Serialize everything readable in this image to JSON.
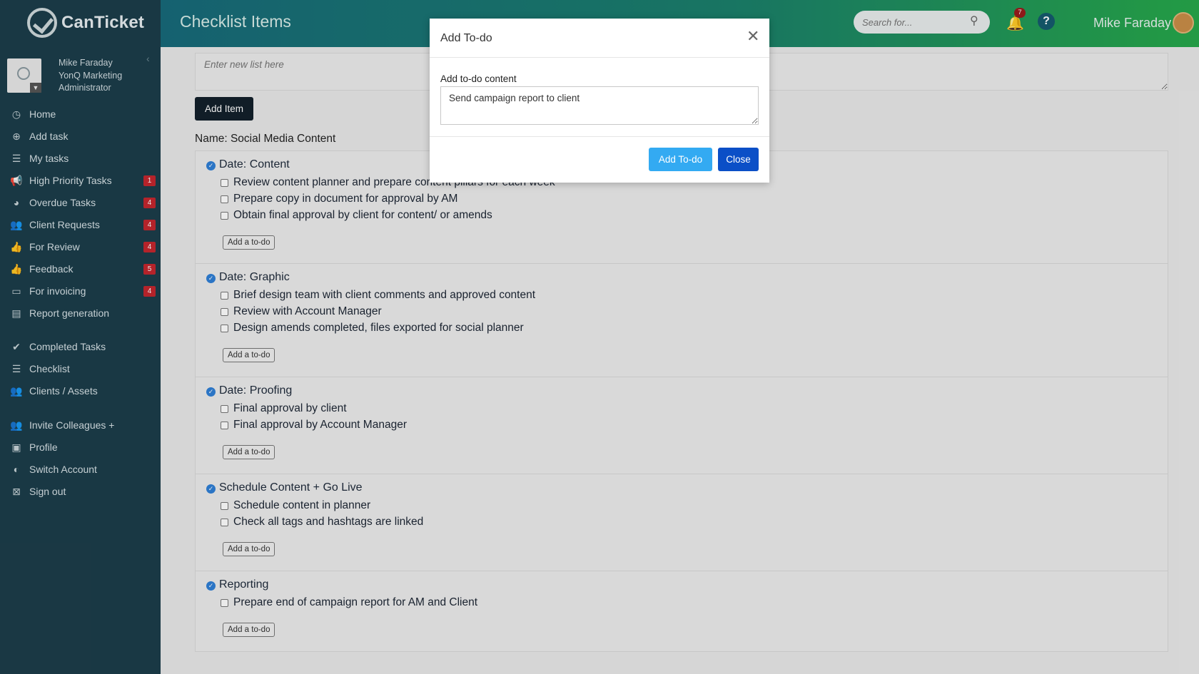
{
  "app": {
    "name": "CanTicket",
    "page_title": "Checklist Items"
  },
  "sidebar": {
    "user": {
      "name": "Mike Faraday",
      "company": "YonQ Marketing",
      "role": "Administrator"
    },
    "items": [
      {
        "label": "Home",
        "icon": "clock-icon",
        "glyph": "◷"
      },
      {
        "label": "Add task",
        "icon": "plus-circle-icon",
        "glyph": "⊕"
      },
      {
        "label": "My tasks",
        "icon": "list-icon",
        "glyph": "☰"
      },
      {
        "label": "High Priority Tasks",
        "icon": "megaphone-icon",
        "glyph": "📢",
        "badge": "1"
      },
      {
        "label": "Overdue Tasks",
        "icon": "clock-icon",
        "glyph": "◕",
        "badge": "4"
      },
      {
        "label": "Client Requests",
        "icon": "users-icon",
        "glyph": "👥",
        "badge": "4"
      },
      {
        "label": "For Review",
        "icon": "thumbs-up-icon",
        "glyph": "👍",
        "badge": "4"
      },
      {
        "label": "Feedback",
        "icon": "thumbs-up-icon",
        "glyph": "👍",
        "badge": "5"
      },
      {
        "label": "For invoicing",
        "icon": "credit-card-icon",
        "glyph": "▭",
        "badge": "4"
      },
      {
        "label": "Report generation",
        "icon": "report-icon",
        "glyph": "▤"
      },
      {
        "label": "Completed Tasks",
        "icon": "check-circle-icon",
        "glyph": "✔"
      },
      {
        "label": "Checklist",
        "icon": "list-icon",
        "glyph": "☰"
      },
      {
        "label": "Clients / Assets",
        "icon": "users-icon",
        "glyph": "👥"
      },
      {
        "label": "Invite Colleagues +",
        "icon": "users-icon",
        "glyph": "👥"
      },
      {
        "label": "Profile",
        "icon": "id-card-icon",
        "glyph": "▣"
      },
      {
        "label": "Switch Account",
        "icon": "toggle-icon",
        "glyph": "◐"
      },
      {
        "label": "Sign out",
        "icon": "sign-out-icon",
        "glyph": "⊠"
      }
    ]
  },
  "topbar": {
    "search_placeholder": "Search for...",
    "notification_count": "7",
    "help": "?",
    "user_name": "Mike Faraday"
  },
  "main": {
    "new_list_placeholder": "Enter new list here",
    "add_item_label": "Add Item",
    "list_name": "Name: Social Media Content",
    "add_todo_label": "Add a to-do",
    "sections": [
      {
        "title": "Date: Content",
        "todos": [
          "Review content planner and prepare content pillars for each week",
          "Prepare copy in document for approval by AM",
          "Obtain final approval by client for content/ or amends"
        ]
      },
      {
        "title": "Date: Graphic",
        "todos": [
          "Brief design team with client comments and approved content",
          "Review with Account Manager",
          "Design amends completed, files exported for social planner"
        ]
      },
      {
        "title": "Date: Proofing",
        "todos": [
          "Final approval by client",
          "Final approval by Account Manager"
        ]
      },
      {
        "title": "Schedule Content + Go Live",
        "todos": [
          "Schedule content in planner",
          "Check all tags and hashtags are linked"
        ]
      },
      {
        "title": "Reporting",
        "todos": [
          "Prepare end of campaign report for AM and Client"
        ]
      }
    ]
  },
  "modal": {
    "title": "Add To-do",
    "field_label": "Add to-do content",
    "field_value": "Send campaign report to client",
    "add_button": "Add To-do",
    "close_button": "Close"
  }
}
